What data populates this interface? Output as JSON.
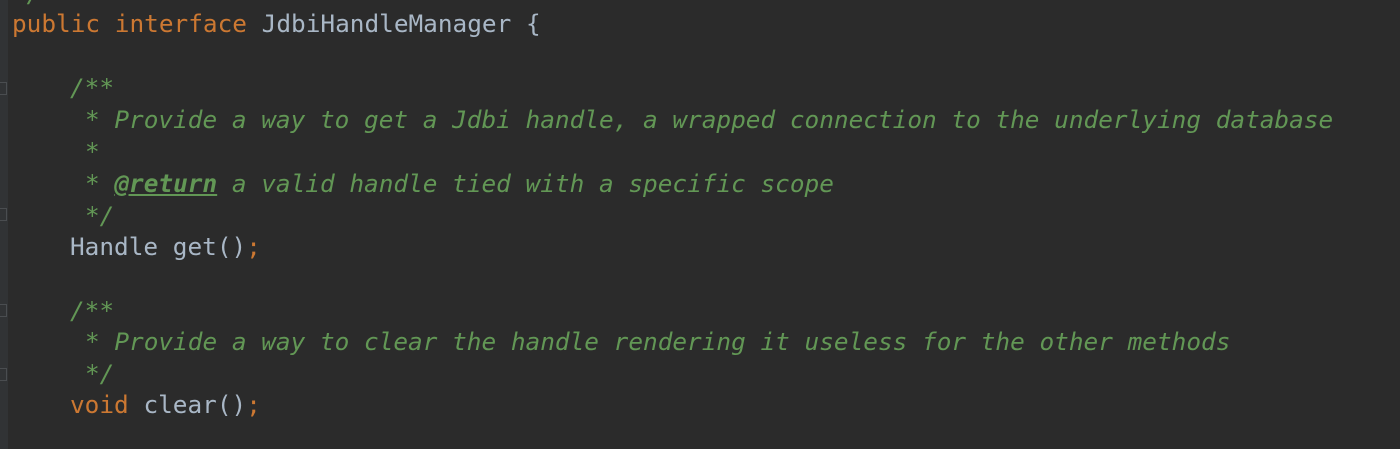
{
  "code": {
    "top_fragment": "*/",
    "line1": {
      "kw1": "public",
      "kw2": "interface",
      "name": "JdbiHandleManager",
      "brace": "{"
    },
    "doc1": {
      "open": "/**",
      "text": "* Provide a way to get a Jdbi handle, a wrapped connection to the underlying database",
      "blank": "*",
      "star": "*",
      "tag": "@return",
      "tag_text": "a valid handle tied with a specific scope",
      "close": "*/"
    },
    "method1": {
      "type": "Handle",
      "name": "get()",
      "semi": ";"
    },
    "doc2": {
      "open": "/**",
      "text": "* Provide a way to clear the handle rendering it useless for the other methods",
      "close": "*/"
    },
    "method2": {
      "type": "void",
      "name": "clear()",
      "semi": ";"
    }
  },
  "colors": {
    "background": "#2b2b2b",
    "keyword": "#cc7832",
    "identifier": "#a9b7c6",
    "doc_comment": "#629755"
  }
}
